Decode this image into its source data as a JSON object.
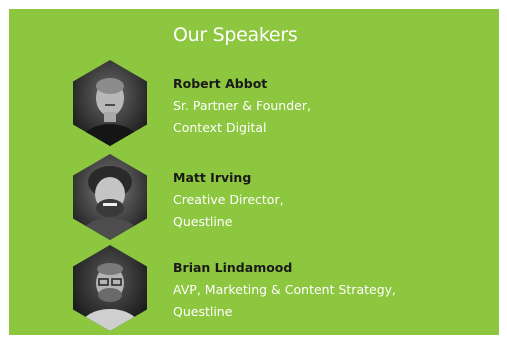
{
  "section": {
    "title": "Our Speakers",
    "background": "#8dc63f"
  },
  "speakers": [
    {
      "name": "Robert Abbot",
      "role": "Sr. Partner & Founder,",
      "company": "Context Digital",
      "icon": "speaker-photo"
    },
    {
      "name": "Matt Irving",
      "role": "Creative Director,",
      "company": "Questline",
      "icon": "speaker-photo"
    },
    {
      "name": "Brian Lindamood",
      "role": "AVP, Marketing & Content Strategy,",
      "company": "Questline",
      "icon": "speaker-photo"
    }
  ]
}
